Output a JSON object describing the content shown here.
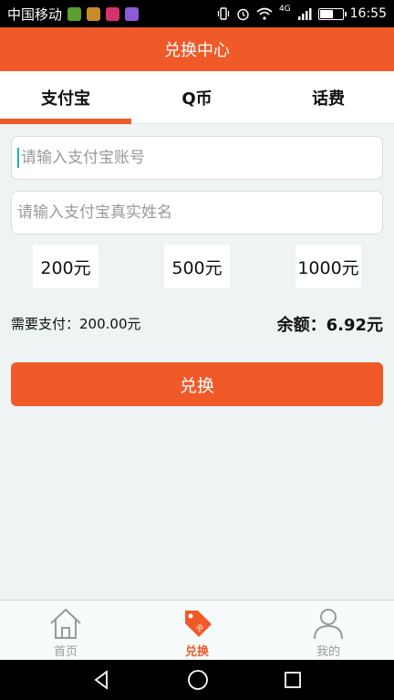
{
  "status_bar": {
    "carrier": "中国移动",
    "network": "4G",
    "time": "16:55"
  },
  "header": {
    "title": "兑换中心"
  },
  "tabs": [
    {
      "label": "支付宝",
      "active": true
    },
    {
      "label": "Q币",
      "active": false
    },
    {
      "label": "话费",
      "active": false
    }
  ],
  "form": {
    "account_placeholder": "请输入支付宝账号",
    "name_placeholder": "请输入支付宝真实姓名",
    "amounts": [
      "200元",
      "500元",
      "1000元"
    ],
    "need_pay": "需要支付：200.00元",
    "balance": "余额：6.92元",
    "submit_label": "兑换"
  },
  "bottom_nav": [
    {
      "label": "首页",
      "icon": "home-icon",
      "active": false
    },
    {
      "label": "兑换",
      "icon": "tag-icon",
      "active": true
    },
    {
      "label": "我的",
      "icon": "user-icon",
      "active": false
    }
  ],
  "colors": {
    "brand": "#f05a28",
    "background": "#eef3f3",
    "inactive_nav": "#9a9a9a"
  }
}
